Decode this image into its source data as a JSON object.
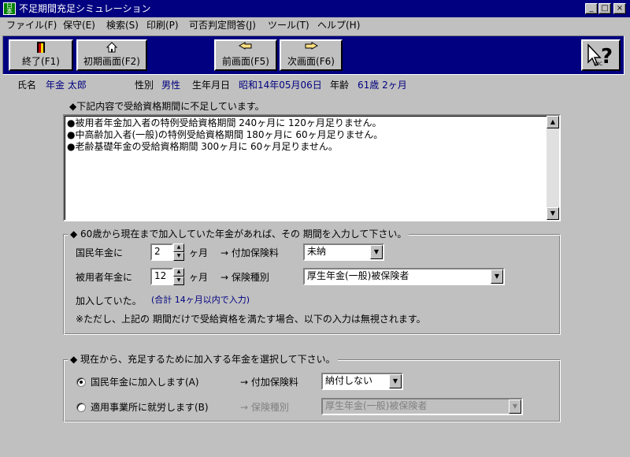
{
  "window": {
    "title": "不足期間充足シミュレーション",
    "icon_text": "日本年",
    "min": "_",
    "max": "□",
    "close": "×"
  },
  "menu": [
    "ファイル(F)",
    "保守(E)",
    "検索(S)",
    "印刷(P)",
    "可否判定問答(J)",
    "ツール(T)",
    "ヘルプ(H)"
  ],
  "toolbar": {
    "exit": "終了(F1)",
    "initial": "初期画面(F2)",
    "prev": "前画面(F5)",
    "next": "次画面(F6)",
    "help_logo": "IMC"
  },
  "info": {
    "name_label": "氏名",
    "name_value": "年金 太郎",
    "gender_label": "性別",
    "gender_value": "男性",
    "dob_label": "生年月日",
    "dob_value": "昭和14年05月06日",
    "age_label": "年齢",
    "age_value": "61歳 2ヶ月"
  },
  "shortage": {
    "heading": "◆下記内容で受給資格期間に不足しています。",
    "lines": [
      "●被用者年金加入者の特例受給資格期間 240ヶ月に 120ヶ月足りません。",
      "●中高齢加入者(一般)の特例受給資格期間 180ヶ月に 60ヶ月足りません。",
      "●老齢基礎年金の受給資格期間 300ヶ月に 60ヶ月足りません。"
    ]
  },
  "since60": {
    "legend": "◆ 60歳から現在まで加入していた年金があれば、その 期間を入力して下さい。",
    "national_label": "国民年金に",
    "national_months": "2",
    "unit": "ヶ月",
    "arrow_surcharge": "→ 付加保険料",
    "surcharge_value": "未納",
    "employee_label": "被用者年金に",
    "employee_months": "12",
    "arrow_type": "→ 保険種別",
    "type_value": "厚生年金(一般)被保険者",
    "joined": "加入していた。",
    "hint": "(合計 14ヶ月以内で入力)",
    "note": "※ただし、上記の 期間だけで受給資格を満たす場合、以下の入力は無視されます。"
  },
  "fill": {
    "legend": "◆ 現在から、充足するために加入する年金を選択して下さい。",
    "opt1_label": "国民年金に加入します(A)",
    "opt1_arrow": "→ 付加保険料",
    "opt1_value": "納付しない",
    "opt2_label": "適用事業所に就労します(B)",
    "opt2_arrow": "→ 保険種別",
    "opt2_value": "厚生年金(一般)被保険者"
  }
}
